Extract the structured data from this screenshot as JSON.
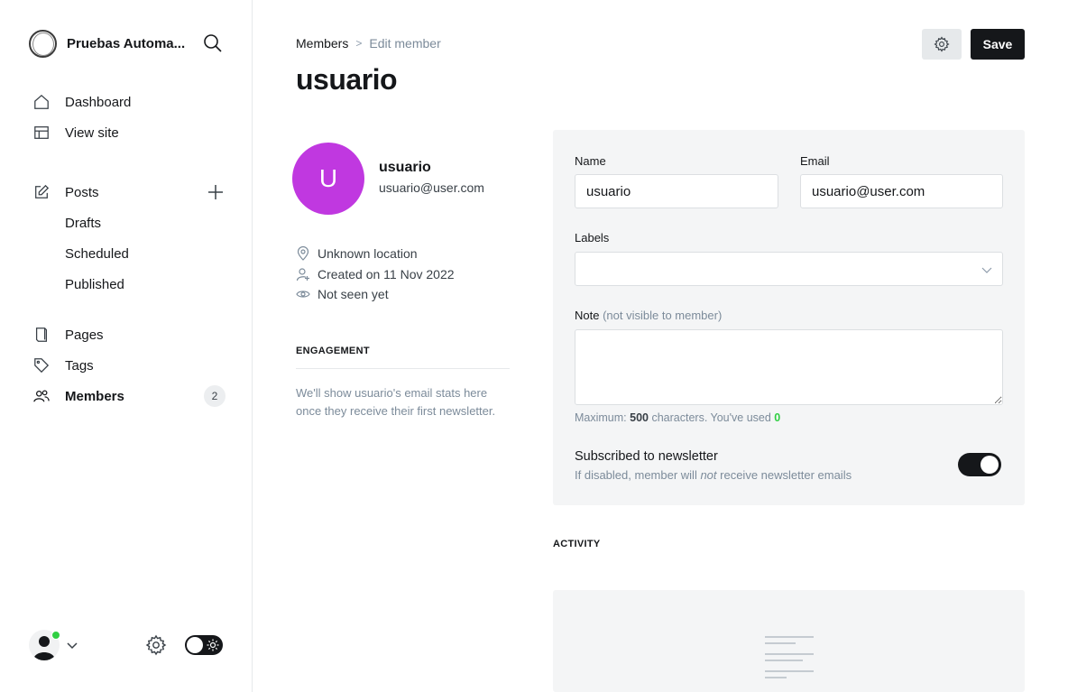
{
  "sidebar": {
    "site_title": "Pruebas Automa...",
    "nav": {
      "dashboard": "Dashboard",
      "view_site": "View site",
      "posts": "Posts",
      "drafts": "Drafts",
      "scheduled": "Scheduled",
      "published": "Published",
      "pages": "Pages",
      "tags": "Tags",
      "members": "Members",
      "members_count": "2"
    },
    "theme_mode": "dark",
    "user_status": "online"
  },
  "header": {
    "breadcrumb_parent": "Members",
    "breadcrumb_separator": ">",
    "breadcrumb_current": "Edit member",
    "title": "usuario",
    "save_label": "Save"
  },
  "member": {
    "avatar_initial": "U",
    "avatar_color": "#c038e0",
    "name": "usuario",
    "email": "usuario@user.com",
    "location": "Unknown location",
    "created": "Created on 11 Nov 2022",
    "last_seen": "Not seen yet"
  },
  "engagement": {
    "title": "ENGAGEMENT",
    "text": "We'll show usuario's email stats here once they receive their first newsletter."
  },
  "form": {
    "name_label": "Name",
    "name_value": "usuario",
    "email_label": "Email",
    "email_value": "usuario@user.com",
    "labels_label": "Labels",
    "note_label": "Note",
    "note_hint": "(not visible to member)",
    "note_value": "",
    "char_prefix": "Maximum: ",
    "char_max": "500",
    "char_middle": " characters. You've used ",
    "char_used": "0",
    "subscribed_title": "Subscribed to newsletter",
    "subscribed_desc_before": "If disabled, member will ",
    "subscribed_desc_em": "not",
    "subscribed_desc_after": " receive newsletter emails",
    "subscribed": true
  },
  "activity": {
    "title": "ACTIVITY"
  },
  "colors": {
    "accent_green": "#30cf43",
    "primary_dark": "#15171a",
    "panel_bg": "#f4f5f6"
  }
}
